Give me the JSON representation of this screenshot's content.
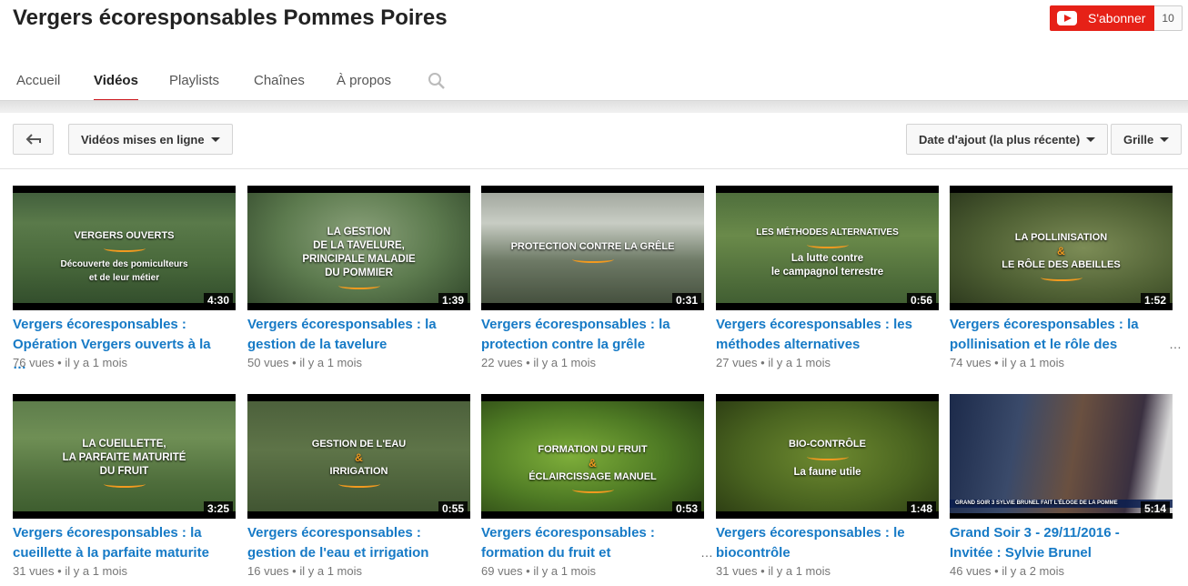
{
  "channel": {
    "title": "Vergers écoresponsables Pommes Poires"
  },
  "subscribe": {
    "label": "S'abonner",
    "count": "10"
  },
  "tabs": [
    "Accueil",
    "Vidéos",
    "Playlists",
    "Chaînes",
    "À propos"
  ],
  "toolbar": {
    "filter": "Vidéos mises en ligne",
    "sort": "Date d'ajout (la plus récente)",
    "view": "Grille"
  },
  "videos": [
    {
      "overlay": [
        "Vergers ouverts",
        "Découverte des pomiculteurs",
        "et de leur métier"
      ],
      "duration": "4:30",
      "title": "Vergers écoresponsables : Opération Vergers ouverts à la …",
      "views": "76 vues",
      "age": "il y a 1 mois"
    },
    {
      "overlay": [
        "La gestion",
        "de la tavelure,",
        "principale maladie",
        "du pommier"
      ],
      "duration": "1:39",
      "title": "Vergers écoresponsables : la gestion de la tavelure",
      "views": "50 vues",
      "age": "il y a 1 mois"
    },
    {
      "overlay": [
        "Protection contre la grêle"
      ],
      "duration": "0:31",
      "title": "Vergers écoresponsables : la protection contre la grêle",
      "views": "22 vues",
      "age": "il y a 1 mois"
    },
    {
      "overlay": [
        "Les méthodes alternatives",
        "La lutte contre",
        "le campagnol terrestre"
      ],
      "duration": "0:56",
      "title": "Vergers écoresponsables : les méthodes alternatives",
      "views": "27 vues",
      "age": "il y a 1 mois"
    },
    {
      "overlay": [
        "La pollinisation",
        "&",
        "Le rôle des abeilles"
      ],
      "duration": "1:52",
      "title": "Vergers écoresponsables : la pollinisation et le rôle des",
      "views": "74 vues",
      "age": "il y a 1 mois"
    },
    {
      "overlay": [
        "La cueillette,",
        "la parfaite maturité",
        "du fruit"
      ],
      "duration": "3:25",
      "title": "Vergers écoresponsables : la cueillette à la parfaite maturite",
      "views": "31 vues",
      "age": "il y a 1 mois"
    },
    {
      "overlay": [
        "Gestion de l'eau",
        "&",
        "irrigation"
      ],
      "duration": "0:55",
      "title": "Vergers écoresponsables : gestion de l'eau et irrigation",
      "views": "16 vues",
      "age": "il y a 1 mois"
    },
    {
      "overlay": [
        "Formation du fruit",
        "&",
        "éclaircissage manuel"
      ],
      "duration": "0:53",
      "title": "Vergers écoresponsables : formation du fruit et",
      "views": "69 vues",
      "age": "il y a 1 mois"
    },
    {
      "overlay": [
        "Bio-contrôle",
        "La faune utile"
      ],
      "duration": "1:48",
      "title": "Vergers écoresponsables : le biocontrôle",
      "views": "31 vues",
      "age": "il y a 1 mois"
    },
    {
      "overlay": [
        "GRAND SOIR 3  SYLVIE BRUNEL FAIT L'ÉLOGE DE LA POMME"
      ],
      "duration": "5:14",
      "title": "Grand Soir 3 - 29/11/2016 - Invitée : Sylvie Brunel",
      "views": "46 vues",
      "age": "il y a 2 mois"
    }
  ],
  "meta_separator": "•",
  "more_glyph": "…",
  "colors": {
    "accent": "#cc181e",
    "subscribe": "#e62117",
    "link": "#167ac6",
    "swoosh": "#f29a1f"
  }
}
